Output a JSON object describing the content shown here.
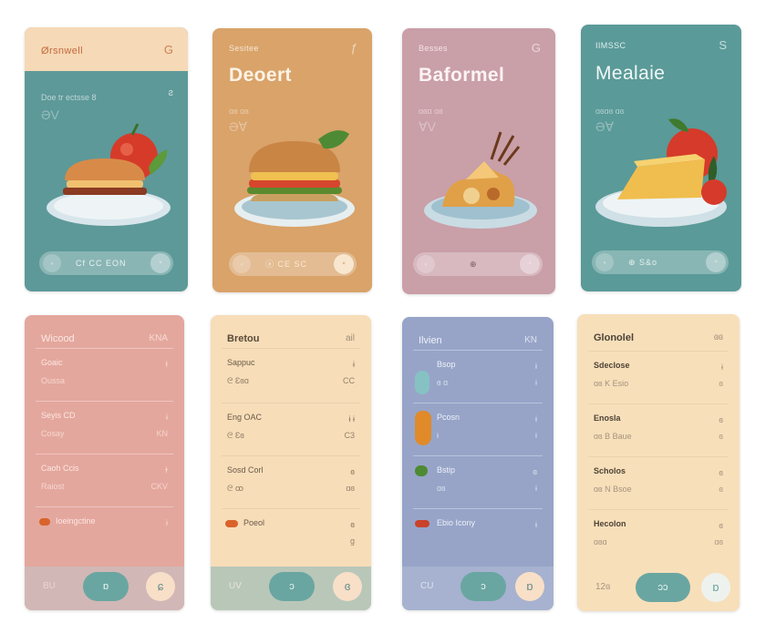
{
  "colors": {
    "teal": "#5d9999",
    "orange": "#d9a36a",
    "mauve": "#c99fa8",
    "teal2": "#5a9a98",
    "pink": "#e4a79d",
    "cream": "#f7ddb8",
    "periwinkle": "#97a4c8",
    "cream2": "#f7dfba",
    "pill_teal": "#6aa6a1"
  },
  "top_cards": [
    {
      "header": "Ørsnwell",
      "header_icon": "G",
      "subtitle": "Doe tr ectsse 8",
      "title": "",
      "scribble": "ƏV",
      "pill_left": "",
      "pill_text": "Cf  CC EON",
      "pill_icon": "◦",
      "food": "burger-tomato-icon"
    },
    {
      "header": "Sesitee",
      "header_icon": "ƒ",
      "subtitle": "",
      "title": "Deoert",
      "scribble": "ƏⱯ",
      "pill_left": "",
      "pill_text": "ⓐ  CE  SC",
      "pill_icon": "◦",
      "food": "burger-icon"
    },
    {
      "header": "Besses",
      "header_icon": "G",
      "subtitle": "",
      "title": "Baformel",
      "scribble": "ⱯV",
      "pill_left": "",
      "pill_text": "⊕",
      "pill_icon": "◦",
      "food": "pastry-bowl-icon"
    },
    {
      "header": "IIMSSC",
      "header_icon": "S",
      "subtitle": "",
      "title": "Mealaie",
      "scribble": "ƏⱯ",
      "pill_left": "",
      "pill_text": "⊕  S&o",
      "pill_icon": "◦",
      "food": "cheese-tomato-icon"
    }
  ],
  "bottom_cards": [
    {
      "heading": "Wicood",
      "heading_right": "KNA",
      "rows": [
        {
          "name": "Goaic",
          "sub": "Oussa",
          "val": "Ɨ",
          "val2": ""
        },
        {
          "name": "Seyis CD",
          "sub": "Cosay",
          "val": "ɨ",
          "val2": "KN"
        },
        {
          "name": "Caoh Ccis",
          "sub": "Raiost",
          "val": "ɫ",
          "val2": "CKV"
        },
        {
          "name": "Ioeingctine",
          "sub": "",
          "val": "ɨ",
          "val2": ""
        }
      ],
      "bar_left": "BU",
      "bar_pill": "ɒ",
      "bar_btn": "ɕ"
    },
    {
      "heading": "Bretou",
      "heading_right": "ail",
      "rows": [
        {
          "name": "Sappuc",
          "sub": "ᘓ  Ɛɞɑ",
          "val": "ɨ",
          "val2": "CC"
        },
        {
          "name": "Eng OAC",
          "sub": "ᘓ  Ɛɞ",
          "val": "ɨ ɨ",
          "val2": "C3"
        },
        {
          "name": "Sosd Corl",
          "sub": "ᘓ  ꝏ",
          "val": "ɞ",
          "val2": "ɑɞ"
        },
        {
          "name": "Poeol",
          "sub": "",
          "val": "ɞ",
          "val2": "ɡ"
        }
      ],
      "bar_left": "UV",
      "bar_pill": "ɔ",
      "bar_btn": "ɞ"
    },
    {
      "heading": "Ilvien",
      "heading_right": "KN",
      "rows": [
        {
          "name": "Bsop",
          "sub": "ɞ ɑ",
          "val": "ɨ",
          "val2": "ɨ"
        },
        {
          "name": "Pcosn",
          "sub": "ɨ",
          "val": "ɨ",
          "val2": "ɨ"
        },
        {
          "name": "Bstip",
          "sub": "ɑɞ",
          "val": "ɞ",
          "val2": "ɨ"
        },
        {
          "name": "Ebio Icony",
          "sub": "",
          "val": "ɨ",
          "val2": ""
        }
      ],
      "bar_left": "CU",
      "bar_pill": "ɔ",
      "bar_btn": "ɒ"
    },
    {
      "heading": "Glonolel",
      "heading_right": "ɞɞ",
      "rows": [
        {
          "name": "Sdeclose",
          "sub": "ɑɞ K Esio",
          "val": "ɨ",
          "val2": "ɞ"
        },
        {
          "name": "Enosla",
          "sub": "ɑɞ B Baue",
          "val": "ɞ",
          "val2": "ɞ"
        },
        {
          "name": "Scholos",
          "sub": "ɑɞ N Bsoe",
          "val": "ɞ",
          "val2": "ɞ"
        },
        {
          "name": "Hecolon",
          "sub": "ɑɞɑ",
          "val": "ɞ",
          "val2": "ɑɞ"
        }
      ],
      "bar_left": "12ɞ",
      "bar_pill": "ɔɔ",
      "bar_btn": "ɒ"
    }
  ]
}
